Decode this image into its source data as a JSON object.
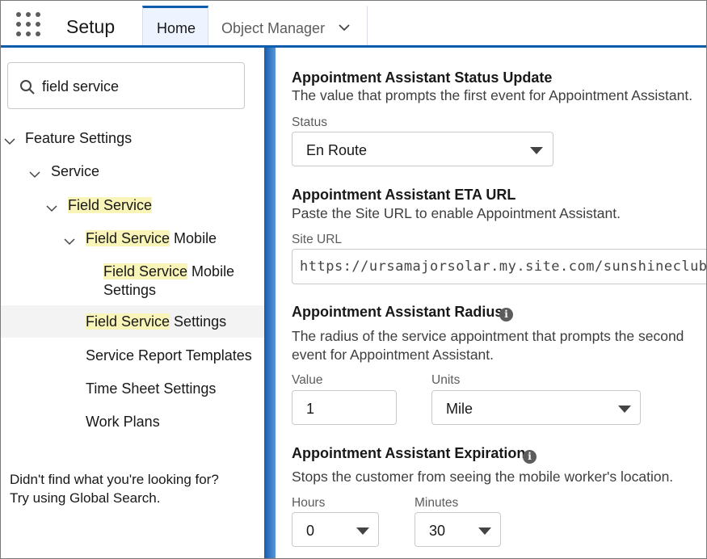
{
  "header": {
    "app_title": "Setup",
    "tabs": [
      {
        "label": "Home",
        "active": true
      },
      {
        "label": "Object Manager",
        "has_dropdown": true
      }
    ]
  },
  "sidebar": {
    "search": {
      "value": "field service",
      "icon": "search-icon"
    },
    "tree": [
      {
        "label": "Feature Settings",
        "highlight": "",
        "rest": "Feature Settings"
      },
      {
        "label": "Service",
        "highlight": "",
        "rest": "Service"
      },
      {
        "label": "Field Service",
        "highlight": "Field Service",
        "rest": ""
      },
      {
        "label": "Field Service Mobile",
        "highlight": "Field Service",
        "rest": " Mobile"
      },
      {
        "label": "Field Service Mobile Settings",
        "highlight": "Field Service",
        "rest": " Mobile",
        "rest2": "Settings"
      },
      {
        "label": "Field Service Settings",
        "highlight": "Field Service",
        "rest": " Settings",
        "selected": true
      },
      {
        "label": "Service Report Templates",
        "rest": "Service Report Templates"
      },
      {
        "label": "Time Sheet Settings",
        "rest": "Time Sheet Settings"
      },
      {
        "label": "Work Plans",
        "rest": "Work Plans"
      }
    ],
    "help_line1": "Didn't find what you're looking for?",
    "help_line2": "Try using Global Search."
  },
  "main": {
    "status_update": {
      "title": "Appointment Assistant Status Update",
      "description": "The value that prompts the first event for Appointment Assistant.",
      "field_label": "Status",
      "value": "En Route"
    },
    "eta_url": {
      "title": "Appointment Assistant ETA URL",
      "description": "Paste the Site URL to enable Appointment Assistant.",
      "field_label": "Site URL",
      "value": "https://ursamajorsolar.my.site.com/sunshineclub"
    },
    "radius": {
      "title": "Appointment Assistant Radius",
      "description_line1": "The radius of the service appointment that prompts the second",
      "description_line2": "event for Appointment Assistant.",
      "value_label": "Value",
      "value": "1",
      "units_label": "Units",
      "units": "Mile"
    },
    "expiration": {
      "title": "Appointment Assistant Expiration",
      "description": "Stops the customer from seeing the mobile worker's location.",
      "hours_label": "Hours",
      "hours": "0",
      "minutes_label": "Minutes",
      "minutes": "30"
    }
  },
  "colors": {
    "brand_blue": "#0b5cab",
    "highlight": "#f9f5b8",
    "selected_row": "#f3f3f3"
  }
}
